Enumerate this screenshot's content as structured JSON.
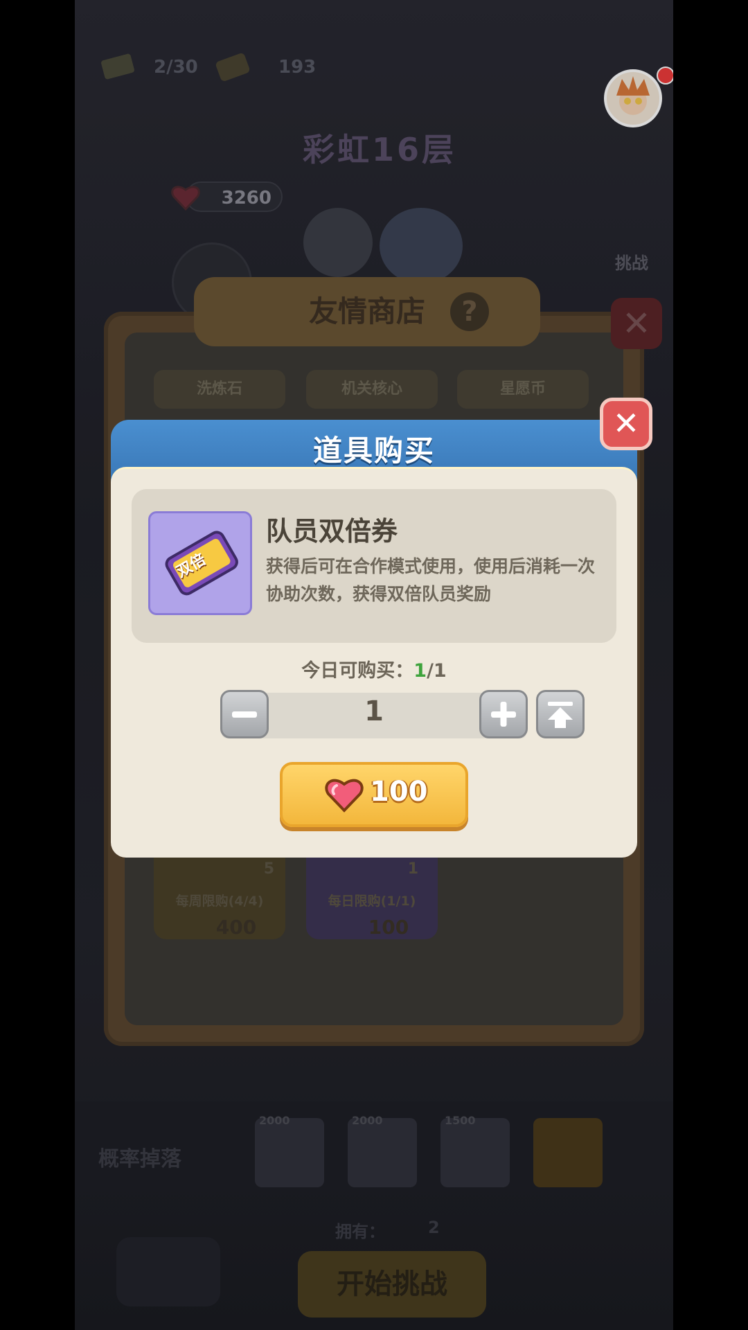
{
  "hud": {
    "energy": "2/30",
    "coins": "193",
    "hearts": "3260",
    "floor_title": "彩虹16层",
    "challenge_label": "挑战"
  },
  "shop": {
    "title": "友情商店",
    "help": "?",
    "tabs": [
      "洗炼石",
      "机关核心",
      "星愿币"
    ],
    "cards": [
      {
        "count": "5",
        "limit": "每周限购(4/4)",
        "price": "400"
      },
      {
        "count": "1",
        "limit": "每日限购(1/1)",
        "price": "100"
      }
    ]
  },
  "bottom": {
    "drop_label": "概率掉落",
    "reward_counts": [
      "2000",
      "2000",
      "1500"
    ],
    "owned_label": "拥有：",
    "owned_value": "2",
    "start_label": "开始挑战"
  },
  "modal": {
    "title": "道具购买",
    "item_name": "队员双倍券",
    "item_desc": "获得后可在合作模式使用，使用后消耗一次协助次数，获得双倍队员奖励",
    "item_icon_text": "双倍",
    "limit_label": "今日可购买：",
    "limit_current": "1",
    "limit_total": "/1",
    "quantity": "1",
    "price": "100"
  },
  "colors": {
    "modal_header": "#4a8fd0",
    "buy_button": "#f3b73c",
    "close_button": "#e05656",
    "heart": "#e84a63",
    "limit_green": "#3ea33c"
  },
  "icons": [
    "energy-icon",
    "coin-icon",
    "heart-icon",
    "avatar-icon",
    "help-icon",
    "close-icon",
    "minus-icon",
    "plus-icon",
    "max-icon",
    "ticket-icon"
  ]
}
